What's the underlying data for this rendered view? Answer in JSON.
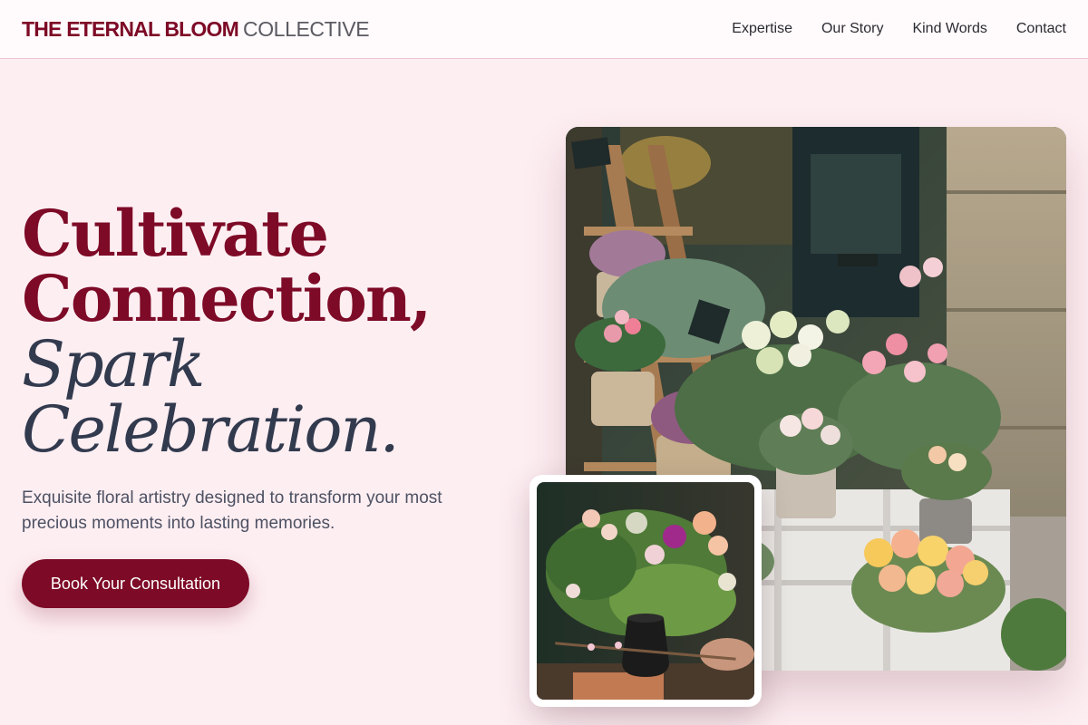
{
  "header": {
    "logo_strong": "THE ETERNAL BLOOM",
    "logo_light": "COLLECTIVE",
    "nav": [
      "Expertise",
      "Our Story",
      "Kind Words",
      "Contact"
    ]
  },
  "hero": {
    "title_lines": [
      "Cultivate",
      "Connection,",
      "Spark",
      "Celebration."
    ],
    "subtitle": "Exquisite floral artistry designed to transform your most precious moments into lasting memories.",
    "cta_label": "Book Your Consultation"
  },
  "images": {
    "main_alt": "Flower shop storefront with baskets and buckets of roses",
    "inset_alt": "Florist arranging a bouquet in a black vase"
  },
  "colors": {
    "brand": "#7d0a26",
    "accent_text": "#323a4e",
    "background": "#fdeef2"
  }
}
